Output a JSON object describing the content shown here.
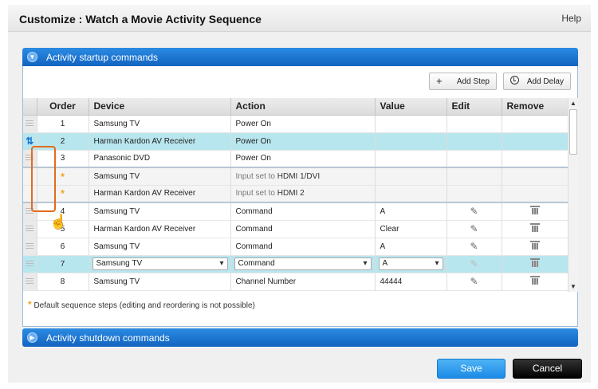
{
  "dialog": {
    "title": "Customize : Watch a Movie Activity Sequence",
    "help_label": "Help"
  },
  "startup_section": {
    "label": "Activity startup commands",
    "add_step_label": "Add Step",
    "add_delay_label": "Add Delay",
    "columns": [
      "Order",
      "Device",
      "Action",
      "Value",
      "Edit",
      "Remove"
    ],
    "rows_top": [
      {
        "order": "1",
        "device": "Samsung TV",
        "action": "Power On"
      },
      {
        "order": "2",
        "device": "Harman Kardon AV Receiver",
        "action": "Power On"
      },
      {
        "order": "3",
        "device": "Panasonic DVD",
        "action": "Power On"
      }
    ],
    "default_rows": [
      {
        "device": "Samsung TV",
        "action_prefix": "Input set to ",
        "action_value": "HDMI 1/DVI"
      },
      {
        "device": "Harman Kardon AV Receiver",
        "action_prefix": "Input set to ",
        "action_value": "HDMI 2"
      }
    ],
    "rows_bottom": [
      {
        "order": "4",
        "device": "Samsung TV",
        "action": "Command",
        "value": "A"
      },
      {
        "order": "5",
        "device": "Harman Kardon AV Receiver",
        "action": "Command",
        "value": "Clear"
      },
      {
        "order": "6",
        "device": "Samsung TV",
        "action": "Command",
        "value": "A"
      },
      {
        "order": "7",
        "device": "Samsung TV",
        "action": "Command",
        "value": "A"
      },
      {
        "order": "8",
        "device": "Samsung TV",
        "action": "Channel Number",
        "value": "44444"
      }
    ],
    "footnote": "Default sequence steps (editing and reordering is not possible)"
  },
  "shutdown_section": {
    "label": "Activity shutdown commands"
  },
  "buttons": {
    "save": "Save",
    "cancel": "Cancel"
  },
  "colors": {
    "section_header": "#1a72d0",
    "highlight_row": "#b8e6ee",
    "drag_outline": "#e36c1c",
    "save_button": "#2a9aef",
    "default_star": "#f5a623"
  },
  "icons": {
    "expand": "chevron-down-icon",
    "collapsed": "chevron-right-icon",
    "add": "plus-icon",
    "delay": "clock-icon",
    "edit": "pencil-icon",
    "remove": "trash-icon",
    "drag": "drag-handle-icon",
    "reorder": "reorder-arrows-icon",
    "cursor": "hand-cursor-icon"
  }
}
